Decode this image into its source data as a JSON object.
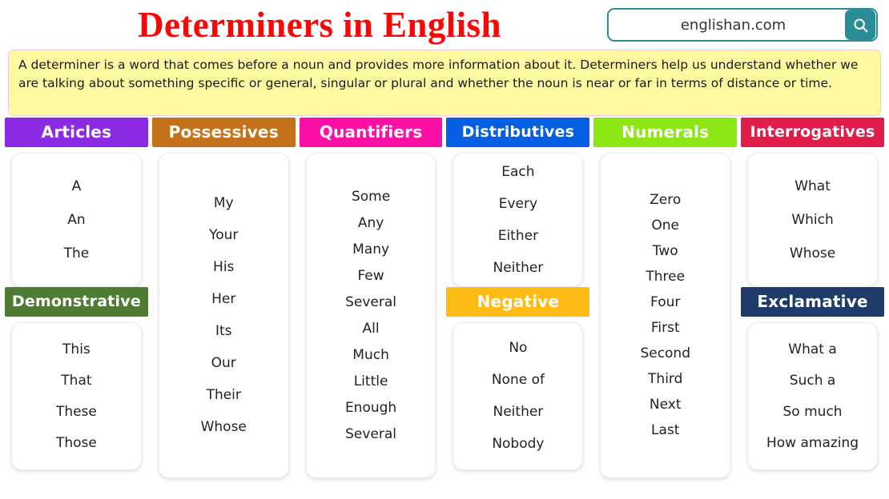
{
  "header": {
    "title": "Determiners in English",
    "search": {
      "value": "englishan.com",
      "placeholder": "englishan.com",
      "button_icon": "search-icon"
    }
  },
  "intro": {
    "text": "A determiner is a word that comes before a noun and provides more information about it. Determiners help us understand whether we are talking about something specific or general, singular or plural and whether the noun is near or far in terms of distance or time."
  },
  "colors": {
    "title": "#fb0505",
    "intro_bg": "#fdf9a0",
    "search_accent": "#2a8c94",
    "articles": "#8c2be2",
    "possessives": "#c3711a",
    "quantifiers": "#fc0fa5",
    "distributives": "#065fe0",
    "numerals": "#8ce614",
    "interrogatives": "#e01d4b",
    "demonstrative": "#4e7c32",
    "negative": "#febb15",
    "exclamative": "#1f3b69"
  },
  "columns": [
    {
      "id": "articles",
      "sections": [
        {
          "header": "Articles",
          "color": "#8c2be2",
          "items": [
            "A",
            "An",
            "The"
          ]
        },
        {
          "header": "Demonstrative",
          "color": "#4e7c32",
          "items": [
            "This",
            "That",
            "These",
            "Those"
          ]
        }
      ]
    },
    {
      "id": "possessives",
      "sections": [
        {
          "header": "Possessives",
          "color": "#c3711a",
          "items": [
            "My",
            "Your",
            "His",
            "Her",
            "Its",
            "Our",
            "Their",
            "Whose"
          ]
        }
      ]
    },
    {
      "id": "quantifiers",
      "sections": [
        {
          "header": "Quantifiers",
          "color": "#fc0fa5",
          "items": [
            "Some",
            "Any",
            "Many",
            "Few",
            "Several",
            "All",
            "Much",
            "Little",
            "Enough",
            "Several"
          ]
        }
      ]
    },
    {
      "id": "distributives",
      "sections": [
        {
          "header": "Distributives",
          "color": "#065fe0",
          "items": [
            "Each",
            "Every",
            "Either",
            "Neither"
          ]
        },
        {
          "header": "Negative",
          "color": "#febb15",
          "items": [
            "No",
            "None of",
            "Neither",
            "Nobody"
          ]
        }
      ]
    },
    {
      "id": "numerals",
      "sections": [
        {
          "header": "Numerals",
          "color": "#8ce614",
          "items": [
            "Zero",
            "One",
            "Two",
            "Three",
            "Four",
            "First",
            "Second",
            "Third",
            "Next",
            "Last"
          ]
        }
      ]
    },
    {
      "id": "interrogatives",
      "sections": [
        {
          "header": "Interrogatives",
          "color": "#e01d4b",
          "items": [
            "What",
            "Which",
            "Whose"
          ]
        },
        {
          "header": "Exclamative",
          "color": "#1f3b69",
          "items": [
            "What a",
            "Such a",
            "So much",
            "How amazing"
          ]
        }
      ]
    }
  ]
}
